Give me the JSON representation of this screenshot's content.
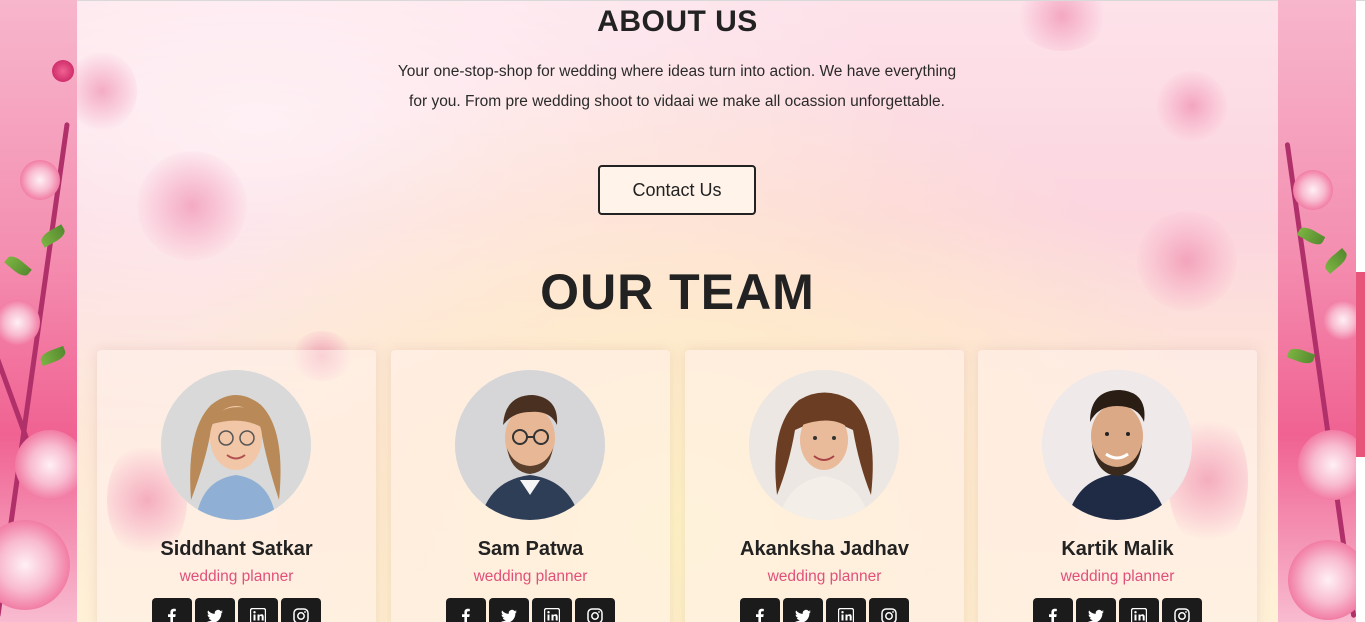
{
  "about": {
    "title": "ABOUT US",
    "text": "Your one-stop-shop for wedding where ideas turn into action. We have everything for you. From pre wedding shoot to vidaai we make all ocassion unforgettable.",
    "contact_label": "Contact Us"
  },
  "team": {
    "title": "OUR TEAM",
    "members": [
      {
        "name": "Siddhant Satkar",
        "role": "wedding planner"
      },
      {
        "name": "Sam Patwa",
        "role": "wedding planner"
      },
      {
        "name": "Akanksha Jadhav",
        "role": "wedding planner"
      },
      {
        "name": "Kartik Malik",
        "role": "wedding planner"
      }
    ],
    "social_icons": [
      "facebook-icon",
      "twitter-icon",
      "linkedin-icon",
      "instagram-icon"
    ]
  },
  "colors": {
    "accent": "#e0507a",
    "text": "#222222",
    "button_dark": "#1b1b1b"
  }
}
